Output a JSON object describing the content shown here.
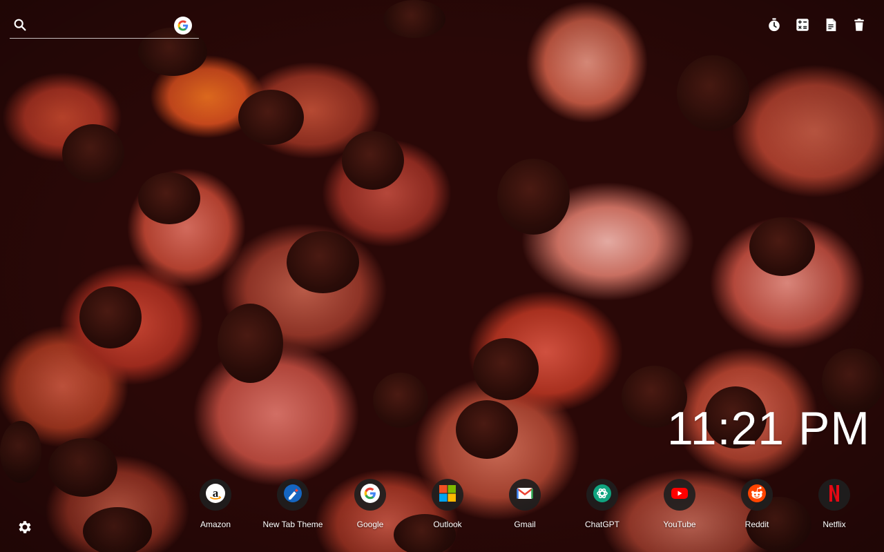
{
  "search": {
    "placeholder": "",
    "engine_icon": "google-icon"
  },
  "toolbar": {
    "buttons": [
      {
        "name": "timer-icon"
      },
      {
        "name": "calculator-icon"
      },
      {
        "name": "notes-icon"
      },
      {
        "name": "trash-icon"
      }
    ]
  },
  "clock": {
    "time": "11:21 PM"
  },
  "shortcuts": [
    {
      "label": "Amazon",
      "icon": "amazon-icon"
    },
    {
      "label": "New Tab Theme",
      "icon": "new-tab-theme-icon"
    },
    {
      "label": "Google",
      "icon": "google-icon"
    },
    {
      "label": "Outlook",
      "icon": "outlook-icon"
    },
    {
      "label": "Gmail",
      "icon": "gmail-icon"
    },
    {
      "label": "ChatGPT",
      "icon": "chatgpt-icon"
    },
    {
      "label": "YouTube",
      "icon": "youtube-icon"
    },
    {
      "label": "Reddit",
      "icon": "reddit-icon"
    },
    {
      "label": "Netflix",
      "icon": "netflix-icon"
    }
  ],
  "settings": {
    "icon": "gear-icon"
  },
  "colors": {
    "google_blue": "#4285F4",
    "google_red": "#EA4335",
    "google_yellow": "#FBBC05",
    "google_green": "#34A853",
    "youtube_red": "#FF0000",
    "reddit_orange": "#FF4500",
    "netflix_red": "#E50914"
  }
}
